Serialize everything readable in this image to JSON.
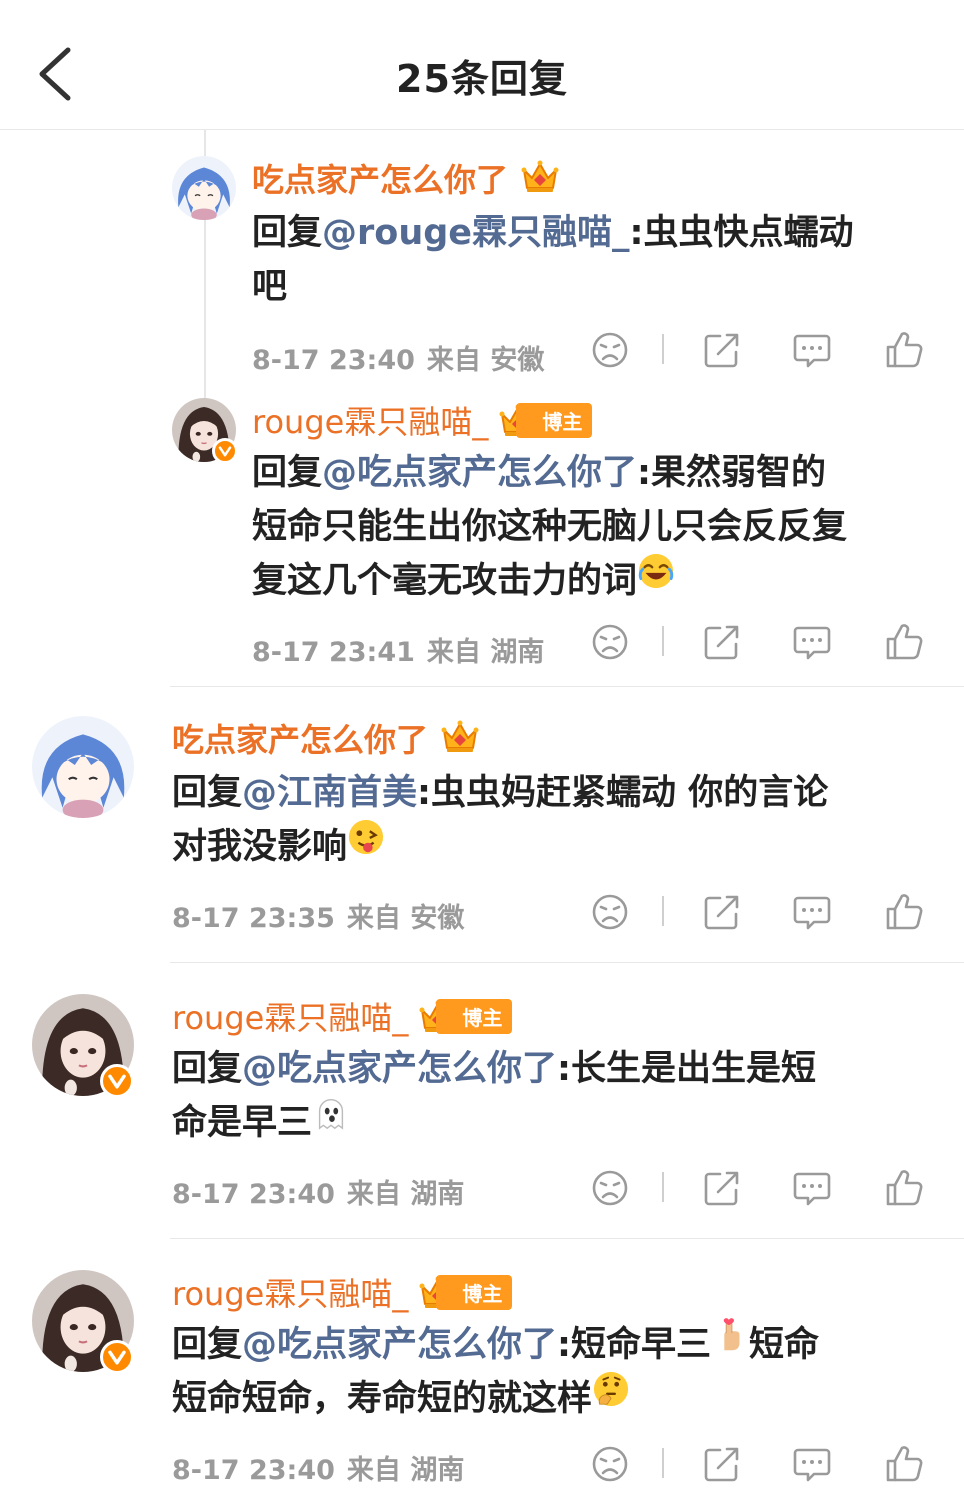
{
  "header": {
    "title": "25条回复",
    "back_icon": "back-arrow-icon"
  },
  "colors": {
    "username": "#eb7126",
    "mention": "#536a93",
    "meta": "#9a9a9a",
    "badge": "#ff9a1f"
  },
  "comments": [
    {
      "username": "吃点家产怎么你了",
      "badge_icon": "crown-icon",
      "reply_prefix": "回复",
      "mention": "@rouge霖只融喵_",
      "colon": ":",
      "lines": [
        "虫虫快点蠕动",
        "吧"
      ],
      "time": "8-17 23:40",
      "location": "来自 安徽"
    },
    {
      "username": "rouge霖只融喵_",
      "badge_label": "博主",
      "reply_prefix": "回复",
      "mention": "@吃点家产怎么你了",
      "colon": ":",
      "lines": [
        "果然弱智的",
        "短命只能生出你这种无脑儿只会反反复",
        "复这几个毫无攻击力的词"
      ],
      "emoji": "laughing-tears-emoji",
      "time": "8-17 23:41",
      "location": "来自 湖南"
    },
    {
      "username": "吃点家产怎么你了",
      "badge_icon": "crown-icon",
      "reply_prefix": "回复",
      "mention": "@江南首美",
      "colon": ":",
      "lines": [
        "虫虫妈赶紧蠕动 你的言论",
        "对我没影响"
      ],
      "emoji": "tongue-out-emoji",
      "time": "8-17 23:35",
      "location": "来自 安徽"
    },
    {
      "username": "rouge霖只融喵_",
      "badge_label": "博主",
      "reply_prefix": "回复",
      "mention": "@吃点家产怎么你了",
      "colon": ":",
      "lines": [
        "长生是出生是短",
        "命是早三"
      ],
      "emoji": "ghost-emoji",
      "time": "8-17 23:40",
      "location": "来自 湖南"
    },
    {
      "username": "rouge霖只融喵_",
      "badge_label": "博主",
      "reply_prefix": "回复",
      "mention": "@吃点家产怎么你了",
      "colon": ":",
      "lines": [
        "短命早三",
        "短命",
        "短命短命，寿命短的就这样"
      ],
      "emoji": "finger-heart-emoji",
      "emoji2": "thinking-face-emoji",
      "time": "8-17 23:40",
      "location": "来自 湖南"
    }
  ],
  "action_icons": [
    "dislike-icon",
    "share-icon",
    "comment-icon",
    "like-icon"
  ]
}
